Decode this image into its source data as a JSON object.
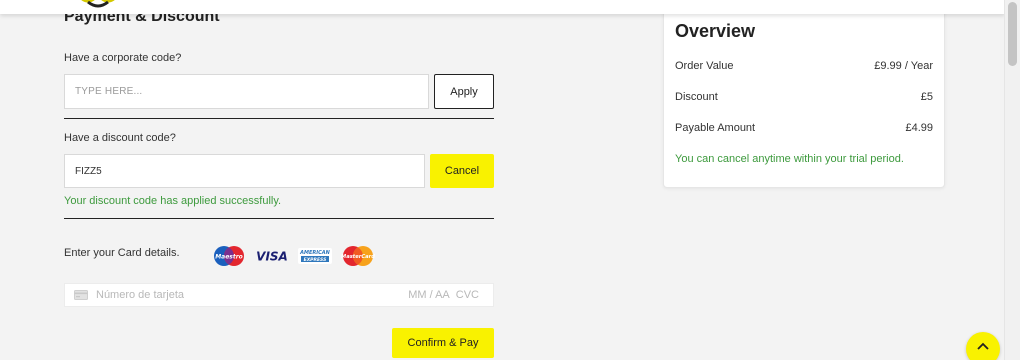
{
  "header": {
    "logo_icon": "brand-logo-icon"
  },
  "payment": {
    "title": "Payment & Discount",
    "corporate": {
      "label": "Have a corporate code?",
      "placeholder": "TYPE HERE...",
      "button": "Apply"
    },
    "discount": {
      "label": "Have a discount code?",
      "value": "FIZZ5",
      "button": "Cancel",
      "success": "Your discount code has applied successfully."
    },
    "card": {
      "label": "Enter your Card details.",
      "logos": [
        "Maestro",
        "VISA",
        "AMERICAN EXPRESS",
        "MasterCard"
      ],
      "number_placeholder": "Número de tarjeta",
      "expiry_placeholder": "MM / AA",
      "cvc_placeholder": "CVC"
    },
    "confirm_button": "Confirm & Pay"
  },
  "overview": {
    "title": "Overview",
    "rows": [
      {
        "label": "Order Value",
        "value": "£9.99 / Year"
      },
      {
        "label": "Discount",
        "value": "£5"
      },
      {
        "label": "Payable Amount",
        "value": "£4.99"
      }
    ],
    "note": "You can cancel anytime within your trial period."
  },
  "colors": {
    "accent": "#f9f200",
    "success": "#3d9a3d",
    "background": "#f3f3f3"
  },
  "icons": {
    "card": "credit-card-icon",
    "scroll_top": "chevron-up-icon"
  }
}
